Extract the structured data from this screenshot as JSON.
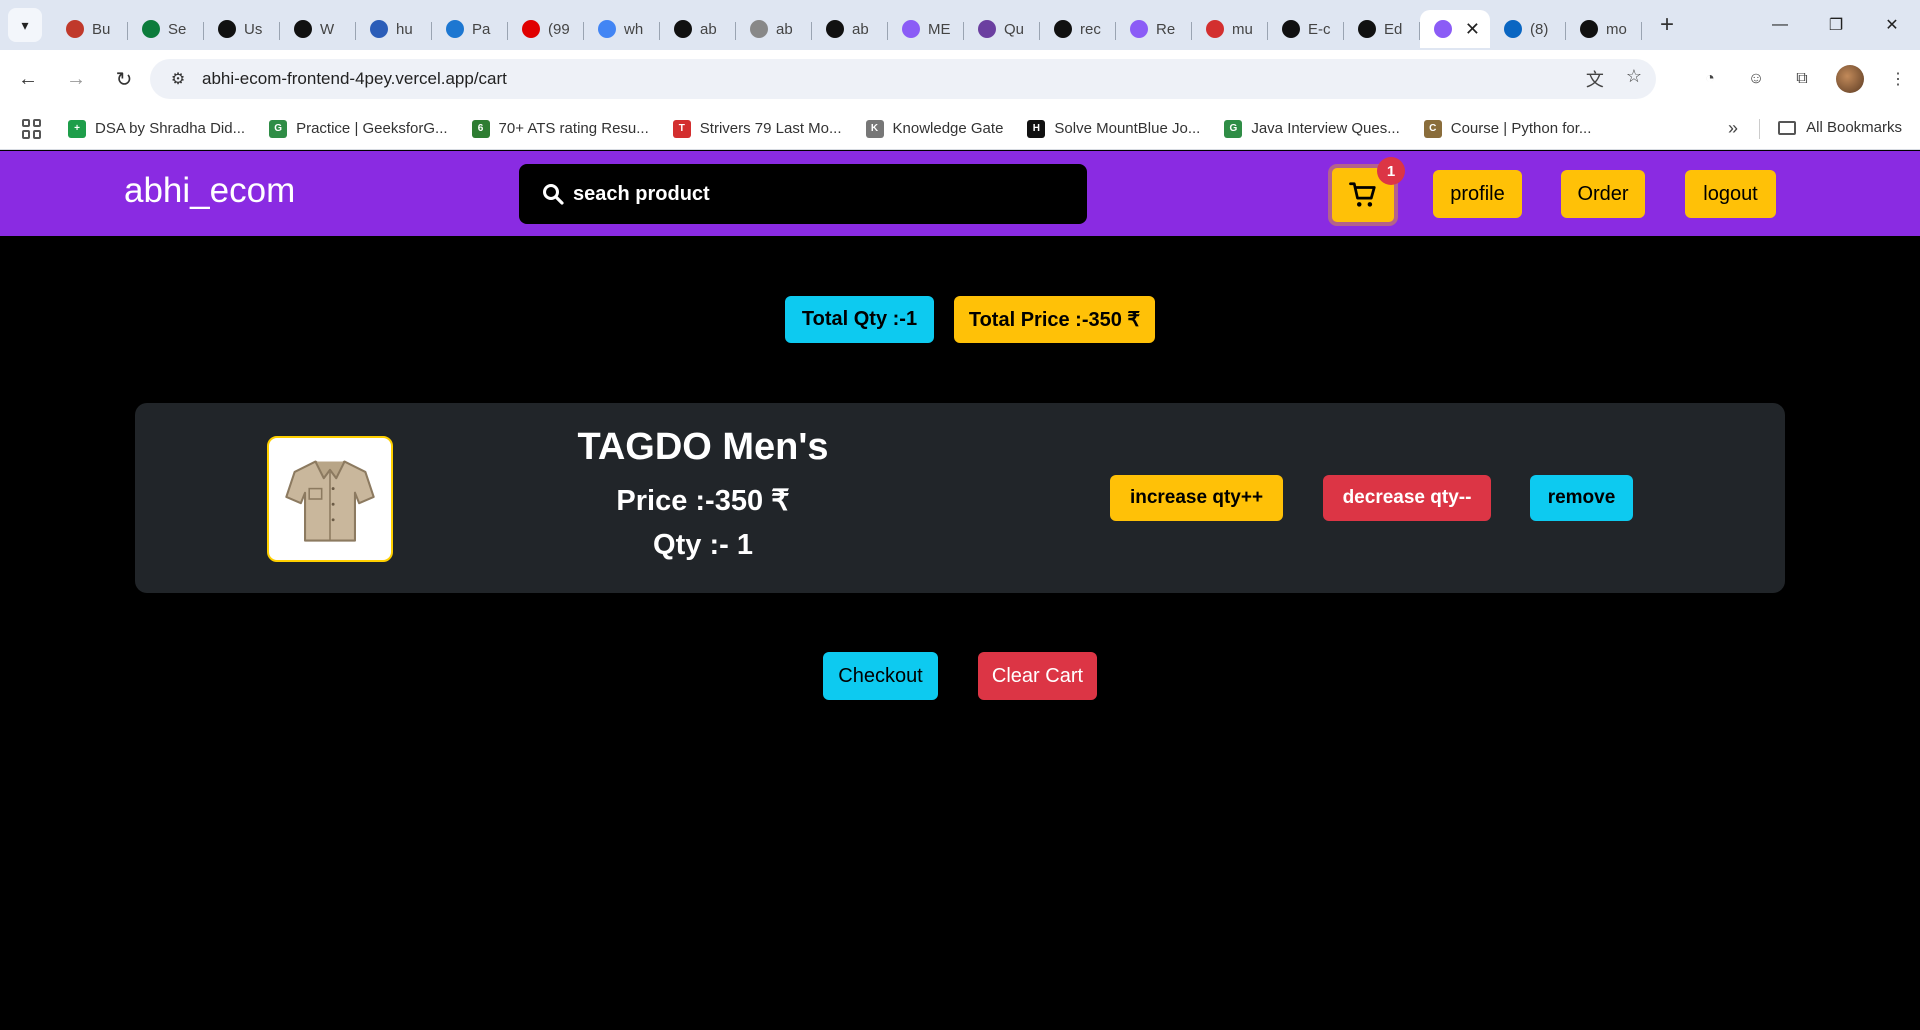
{
  "browser": {
    "tabs": [
      {
        "label": "Bu",
        "color": "#c0392b"
      },
      {
        "label": "Se",
        "color": "#0c7c3c"
      },
      {
        "label": "Us",
        "color": "#111111"
      },
      {
        "label": "W",
        "color": "#111111"
      },
      {
        "label": "hu",
        "color": "#2b5db8"
      },
      {
        "label": "Pa",
        "color": "#1d77d1"
      },
      {
        "label": "(99",
        "color": "#e00000"
      },
      {
        "label": "wh",
        "color": "#4285f4"
      },
      {
        "label": "ab",
        "color": "#111111"
      },
      {
        "label": "ab",
        "color": "#888888"
      },
      {
        "label": "ab",
        "color": "#111111"
      },
      {
        "label": "ME",
        "color": "#8b5cf6"
      },
      {
        "label": "Qu",
        "color": "#6b3fa0"
      },
      {
        "label": "rec",
        "color": "#111111"
      },
      {
        "label": "Re",
        "color": "#8b5cf6"
      },
      {
        "label": "mu",
        "color": "#d32f2f"
      },
      {
        "label": "E-c",
        "color": "#111111"
      },
      {
        "label": "Ed",
        "color": "#111111"
      }
    ],
    "active_tab_color": "#8b5cf6",
    "after_tabs": [
      {
        "label": "(8)",
        "color": "#0a66c2"
      },
      {
        "label": "mo",
        "color": "#111111"
      }
    ],
    "url": "abhi-ecom-frontend-4pey.vercel.app/cart",
    "bookmarks": [
      {
        "label": "DSA by Shradha Did...",
        "color": "#1e9e4a",
        "glyph": "+"
      },
      {
        "label": "Practice | GeeksforG...",
        "color": "#2f8d46",
        "glyph": "G"
      },
      {
        "label": "70+ ATS rating Resu...",
        "color": "#2e7d32",
        "glyph": "6"
      },
      {
        "label": "Strivers 79 Last Mo...",
        "color": "#d32f2f",
        "glyph": "T"
      },
      {
        "label": "Knowledge Gate",
        "color": "#777777",
        "glyph": "K"
      },
      {
        "label": "Solve MountBlue Jo...",
        "color": "#111111",
        "glyph": "H"
      },
      {
        "label": "Java Interview Ques...",
        "color": "#2f8d46",
        "glyph": "G"
      },
      {
        "label": "Course | Python for...",
        "color": "#8a6d3b",
        "glyph": "C"
      }
    ],
    "all_bookmarks": "All Bookmarks"
  },
  "nav": {
    "brand": "abhi_ecom",
    "search_placeholder": "seach product",
    "cart_count": "1",
    "profile": "profile",
    "order": "Order",
    "logout": "logout"
  },
  "totals": {
    "qty": "Total Qty :-1",
    "price": "Total Price :-350 ₹"
  },
  "cart_item": {
    "title": "TAGDO Men's",
    "price": "Price :-350 ₹",
    "qty": "Qty :- 1",
    "increase": "increase qty++",
    "decrease": "decrease qty--",
    "remove": "remove"
  },
  "actions": {
    "checkout": "Checkout",
    "clear": "Clear Cart"
  },
  "colors": {
    "navbar": "#8a2be2",
    "yellow": "#ffc107",
    "cyan": "#0dcaf0",
    "red": "#dc3545",
    "card": "#212529"
  }
}
